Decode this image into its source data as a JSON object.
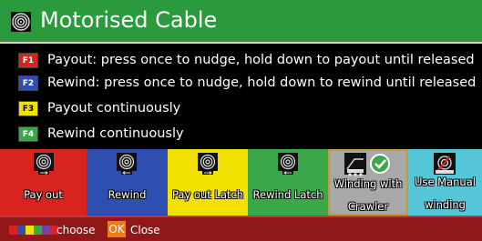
{
  "header": {
    "title": "Motorised Cable",
    "icon": "cable-drum-icon",
    "background": "#2a9a3c"
  },
  "help": [
    {
      "key": "F1",
      "key_color": "#d9231f",
      "key_text_color": "#ffffff",
      "text": "Payout: press once to nudge, hold down to payout until released"
    },
    {
      "key": "F2",
      "key_color": "#2f4fb0",
      "key_text_color": "#ffffff",
      "text": "Rewind: press once to nudge, hold down to rewind until released"
    },
    {
      "key": "F3",
      "key_color": "#f2e000",
      "key_text_color": "#000000",
      "text": "Payout continuously"
    },
    {
      "key": "F4",
      "key_color": "#3aa848",
      "key_text_color": "#ffffff",
      "text": "Rewind continuously"
    }
  ],
  "tiles": [
    {
      "name": "tile-pay-out",
      "label_lines": [
        "Pay out"
      ],
      "color": "#d9231f",
      "icon": "cable-drum-icon"
    },
    {
      "name": "tile-rewind",
      "label_lines": [
        "Rewind"
      ],
      "color": "#2f4fb0",
      "icon": "cable-drum-icon"
    },
    {
      "name": "tile-pay-out-latch",
      "label_lines": [
        "Pay out Latch"
      ],
      "color": "#f2e000",
      "icon": "cable-drum-icon"
    },
    {
      "name": "tile-rewind-latch",
      "label_lines": [
        "Rewind Latch"
      ],
      "color": "#3aa848",
      "icon": "cable-drum-icon"
    },
    {
      "name": "tile-winding-with-crawler",
      "label_lines": [
        "Winding with",
        "Crawler"
      ],
      "color": "#a8a8a8",
      "icon": "crawler-check-icon"
    },
    {
      "name": "tile-use-manual-winding",
      "label_lines": [
        "Use Manual",
        "winding"
      ],
      "color": "#55c5d8",
      "icon": "manual-winding-icon"
    }
  ],
  "footer": {
    "choose_label": "choose",
    "ok_label": "OK",
    "close_label": "Close",
    "background": "#901818",
    "ok_color": "#f07a1a",
    "color_keys": [
      "#d9231f",
      "#2f4fb0",
      "#f2e000",
      "#3aa848",
      "#7a3fa0",
      "#d9231f"
    ]
  }
}
